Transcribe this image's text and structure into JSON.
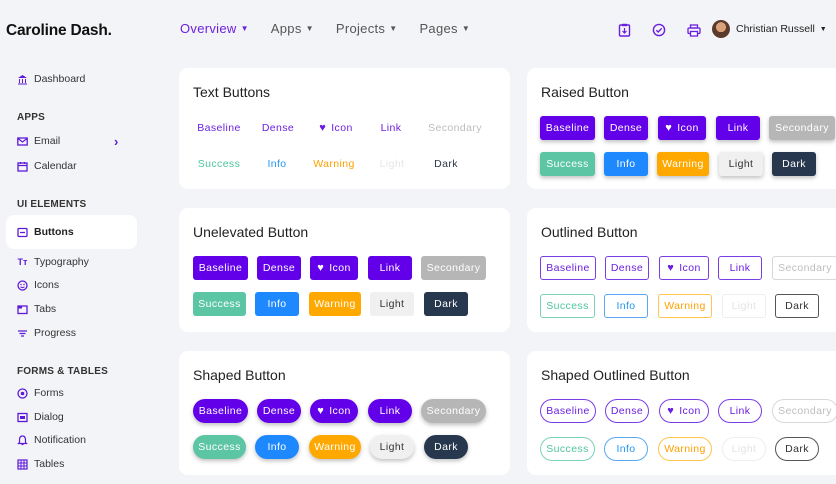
{
  "brand": "Caroline Dash.",
  "sidebar": {
    "items_top": [
      {
        "label": "Dashboard"
      }
    ],
    "sections": [
      {
        "title": "APPS",
        "items": [
          {
            "label": "Email"
          },
          {
            "label": "Calendar"
          }
        ]
      },
      {
        "title": "UI ELEMENTS",
        "items": [
          {
            "label": "Buttons"
          },
          {
            "label": "Typography"
          },
          {
            "label": "Icons"
          },
          {
            "label": "Tabs"
          },
          {
            "label": "Progress"
          }
        ]
      },
      {
        "title": "FORMS & TABLES",
        "items": [
          {
            "label": "Forms"
          },
          {
            "label": "Dialog"
          },
          {
            "label": "Notification"
          },
          {
            "label": "Tables"
          }
        ]
      }
    ],
    "active_item": "Buttons"
  },
  "topnav": [
    {
      "label": "Overview"
    },
    {
      "label": "Apps"
    },
    {
      "label": "Projects"
    },
    {
      "label": "Pages"
    }
  ],
  "user": {
    "name": "Christian Russell"
  },
  "colors": {
    "accent": "#6200ea",
    "success": "#5cc5a3",
    "info": "#1e88ff",
    "warning": "#ffa800",
    "dark": "#27374d"
  },
  "cards": {
    "text": {
      "title": "Text Buttons"
    },
    "raised": {
      "title": "Raised Button"
    },
    "unelevated": {
      "title": "Unelevated Button"
    },
    "outlined": {
      "title": "Outlined Button"
    },
    "shaped": {
      "title": "Shaped Button"
    },
    "shaped_outlined": {
      "title": "Shaped Outlined Button"
    }
  },
  "buttons": {
    "baseline": "Baseline",
    "dense": "Dense",
    "icon": "Icon",
    "link": "Link",
    "secondary": "Secondary",
    "success": "Success",
    "info": "Info",
    "warning": "Warning",
    "light": "Light",
    "dark": "Dark"
  }
}
